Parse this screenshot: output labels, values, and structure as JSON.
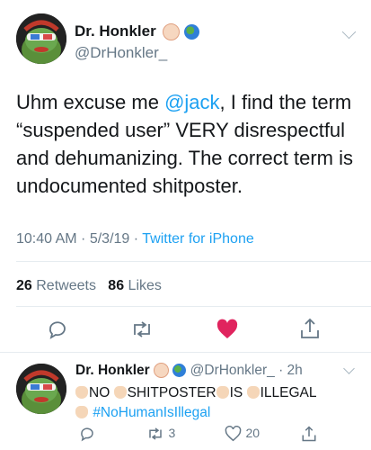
{
  "tweet": {
    "author_name": "Dr. Honkler",
    "author_handle": "@DrHonkler_",
    "text_before": "Uhm excuse me ",
    "mention": "@jack",
    "text_after": ", I find the term “suspended user” VERY disrespectful and dehumanizing. The correct term is undocumented shitposter.",
    "time": "10:40 AM",
    "sep1": " · ",
    "date": "5/3/19",
    "sep2": " · ",
    "source": "Twitter for iPhone",
    "retweets_count": "26",
    "retweets_label": "Retweets",
    "likes_count": "86",
    "likes_label": "Likes"
  },
  "reply": {
    "author_name": "Dr. Honkler",
    "author_handle": "@DrHonkler_",
    "time_sep": " · ",
    "time": "2h",
    "words": [
      "NO",
      "SHITPOSTER",
      "IS",
      "ILLEGAL"
    ],
    "hashtag": "#NoHumanIsIllegal",
    "retweet_count": "3",
    "like_count": "20"
  },
  "icons": {
    "reply": "reply-icon",
    "retweet": "retweet-icon",
    "like": "heart-icon",
    "share": "share-icon",
    "menu": "chevron-down-icon",
    "clap": "clap-emoji-icon"
  },
  "colors": {
    "link": "#1da1f2",
    "heart": "#e0245e",
    "muted": "#657786"
  }
}
